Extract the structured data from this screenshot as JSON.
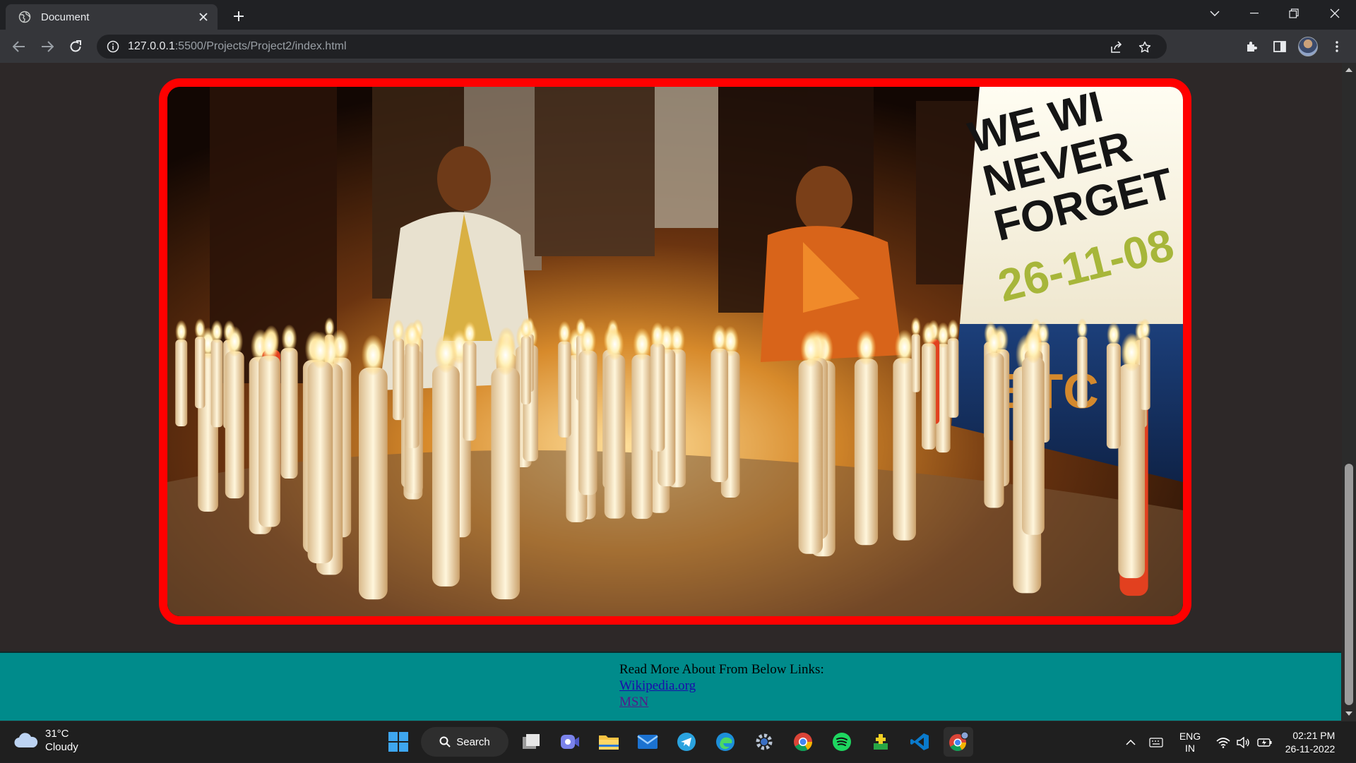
{
  "browser": {
    "tab_title": "Document",
    "url_host": "127.0.0.1",
    "url_path": ":5500/Projects/Project2/index.html"
  },
  "page": {
    "photo": {
      "sign_lines": [
        "WE WI",
        "NEVER",
        "FORGET"
      ],
      "sign_date": "26-11-08",
      "sign_brand": "BTC",
      "frame_color": "#ff0000"
    },
    "footer": {
      "heading": "Read More About From Below Links:",
      "links": [
        {
          "label": "Wikipedia.org"
        },
        {
          "label": "MSN"
        }
      ],
      "background": "#008b8b"
    }
  },
  "taskbar": {
    "weather": {
      "temp": "31°C",
      "condition": "Cloudy"
    },
    "search_label": "Search",
    "apps": [
      "windows-start",
      "search",
      "task-view",
      "teams",
      "file-explorer",
      "mail",
      "telegram",
      "edge",
      "settings",
      "chrome",
      "spotify",
      "app-green",
      "vscode",
      "chrome-profile"
    ],
    "language": {
      "line1": "ENG",
      "line2": "IN"
    },
    "clock": {
      "time": "02:21 PM",
      "date": "26-11-2022"
    }
  }
}
